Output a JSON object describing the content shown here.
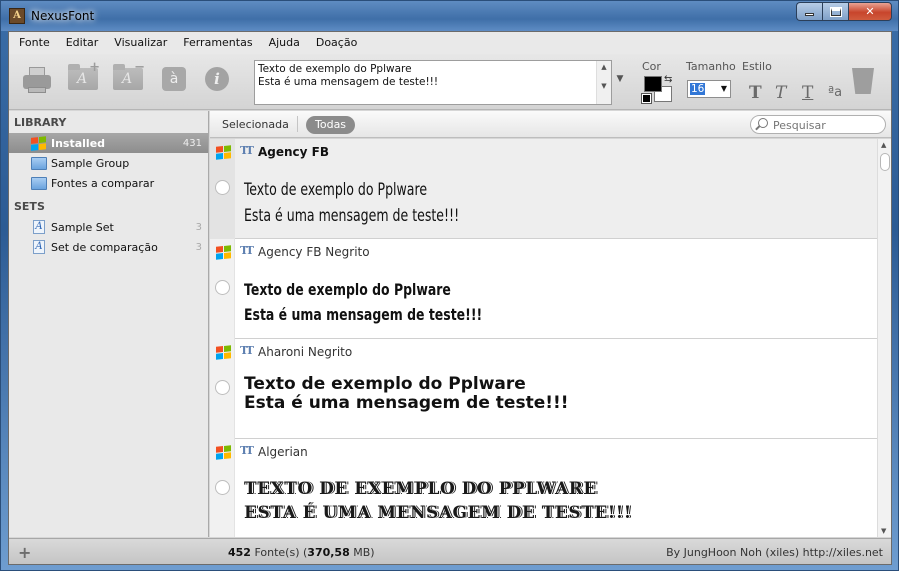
{
  "window": {
    "title": "NexusFont",
    "app_icon_letter": "A"
  },
  "menu": [
    "Fonte",
    "Editar",
    "Visualizar",
    "Ferramentas",
    "Ajuda",
    "Doação"
  ],
  "toolbar": {
    "sample_text": "Texto de exemplo do Pplware\nEsta é uma mensagem de teste!!!",
    "color_label": "Cor",
    "size_label": "Tamanho",
    "size_value": "16",
    "style_label": "Estilo",
    "style_buttons": [
      "T",
      "T",
      "T",
      "ªa"
    ],
    "char_icon_glyph": "à",
    "info_icon_glyph": "i",
    "folder_icon_glyph": "A"
  },
  "sidebar": {
    "library_heading": "LIBRARY",
    "library_items": [
      {
        "label": "Installed",
        "count": "431",
        "selected": true
      },
      {
        "label": "Sample Group",
        "count": ""
      },
      {
        "label": "Fontes a comparar",
        "count": ""
      }
    ],
    "sets_heading": "SETS",
    "set_items": [
      {
        "label": "Sample Set",
        "count": "3"
      },
      {
        "label": "Set de comparação",
        "count": "3"
      }
    ]
  },
  "filter": {
    "selected_label": "Selecionada",
    "all_label": "Todas",
    "search_placeholder": "Pesquisar"
  },
  "fonts": [
    {
      "name": "Agency FB",
      "sample_line1": "Texto de exemplo do Pplware",
      "sample_line2": "Esta é uma mensagem de teste!!!",
      "selected": true
    },
    {
      "name": "Agency FB Negrito",
      "sample_line1": "Texto de exemplo do Pplware",
      "sample_line2": "Esta é uma mensagem de teste!!!"
    },
    {
      "name": "Aharoni Negrito",
      "sample_line1": "Texto de exemplo do Pplware",
      "sample_line2": "Esta é uma mensagem de teste!!!"
    },
    {
      "name": "Algerian",
      "sample_line1": "TEXTO DE EXEMPLO DO PPLWARE",
      "sample_line2": "ESTA É UMA MENSAGEM DE TESTE!!!"
    }
  ],
  "status": {
    "count": "452",
    "count_suffix": " Fonte(s) (",
    "size": "370,58",
    "size_suffix": " MB)",
    "credit": "By JungHoon Noh (xiles)  http://xiles.net"
  },
  "colors": {
    "accent": "#3277d6",
    "windows_logo": [
      "#f25022",
      "#7fba00",
      "#00a4ef",
      "#ffb900"
    ]
  }
}
